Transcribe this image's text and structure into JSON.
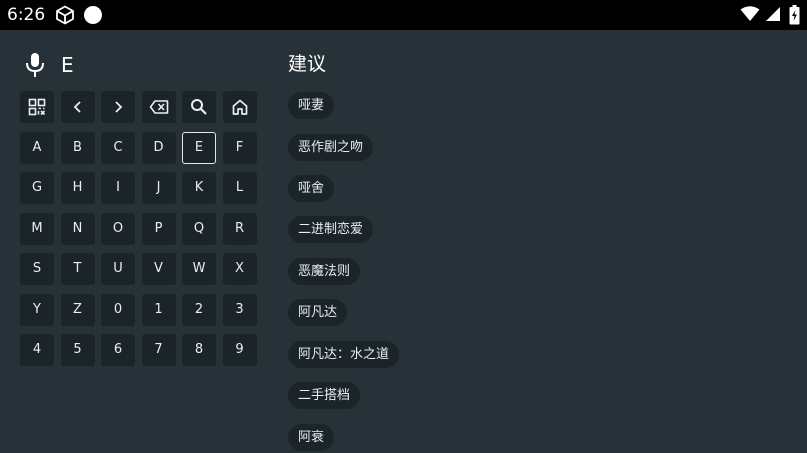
{
  "status_bar": {
    "time": "6:26"
  },
  "search": {
    "query": "E"
  },
  "keyboard": {
    "rows": [
      [
        "A",
        "B",
        "C",
        "D",
        "E",
        "F"
      ],
      [
        "G",
        "H",
        "I",
        "J",
        "K",
        "L"
      ],
      [
        "M",
        "N",
        "O",
        "P",
        "Q",
        "R"
      ],
      [
        "S",
        "T",
        "U",
        "V",
        "W",
        "X"
      ],
      [
        "Y",
        "Z",
        "0",
        "1",
        "2",
        "3"
      ],
      [
        "4",
        "5",
        "6",
        "7",
        "8",
        "9"
      ]
    ],
    "focused_key": "E"
  },
  "suggestions": {
    "title": "建议",
    "items": [
      "哑妻",
      "恶作剧之吻",
      "哑舍",
      "二进制恋爱",
      "恶魔法则",
      "阿凡达",
      "阿凡达：水之道",
      "二手搭档",
      "阿衰"
    ]
  },
  "colors": {
    "background": "#263238",
    "key_background": "#1b2429",
    "status_bar": "#000000"
  }
}
